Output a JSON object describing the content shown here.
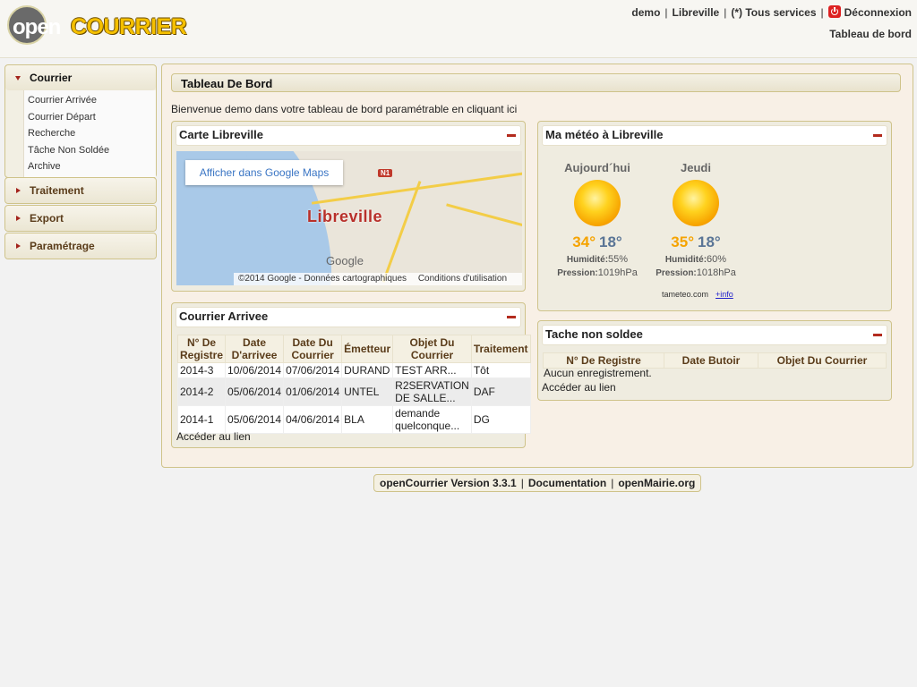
{
  "header": {
    "logo": {
      "part1": "open",
      "part2": "COURRIER"
    },
    "user": "demo",
    "collectivite": "Libreville",
    "services": "(*) Tous services",
    "logout": "Déconnexion",
    "dashboard": "Tableau de bord"
  },
  "menu": {
    "courrier": {
      "label": "Courrier",
      "items": [
        "Courrier Arrivée",
        "Courrier Départ",
        "Recherche",
        "Tâche Non Soldée",
        "Archive"
      ]
    },
    "traitement": "Traitement",
    "export": "Export",
    "parametrage": "Paramétrage"
  },
  "main": {
    "title": "Tableau De Bord",
    "welcome": "Bienvenue demo dans votre tableau de bord paramétrable en cliquant ici"
  },
  "carte": {
    "title": "Carte Libreville",
    "button": "Afficher dans Google Maps",
    "city": "Libreville",
    "road_badge": "N1",
    "brand": "Google",
    "footer": "©2014 Google - Données cartographiques",
    "terms": "Conditions d'utilisation"
  },
  "courrier_arrivee": {
    "title": "Courrier Arrivee",
    "headers": [
      "N° De Registre",
      "Date D'arrivee",
      "Date Du Courrier",
      "Émetteur",
      "Objet Du Courrier",
      "Traitement"
    ],
    "rows": [
      [
        "2014-3",
        "10/06/2014",
        "07/06/2014",
        "DURAND",
        "TEST ARR...",
        "Tôt"
      ],
      [
        "2014-2",
        "05/06/2014",
        "01/06/2014",
        "UNTEL",
        "R2SERVATION DE SALLE...",
        "DAF"
      ],
      [
        "2014-1",
        "05/06/2014",
        "04/06/2014",
        "BLA",
        "demande quelconque...",
        "DG"
      ]
    ],
    "link": "Accéder au lien"
  },
  "meteo": {
    "title": "Ma météo à Libreville",
    "days": [
      {
        "name": "Aujourd´hui",
        "icon": "sun-icon",
        "max": "34°",
        "min": "18°",
        "humidity_label": "Humidité:",
        "humidity": "55%",
        "pressure_label": "Pression:",
        "pressure": "1019hPa"
      },
      {
        "name": "Jeudi",
        "icon": "sun-icon",
        "max": "35°",
        "min": "18°",
        "humidity_label": "Humidité:",
        "humidity": "60%",
        "pressure_label": "Pression:",
        "pressure": "1018hPa"
      }
    ],
    "source": "tameteo.com",
    "more": "+info"
  },
  "tache": {
    "title": "Tache non soldee",
    "headers": [
      "N° De Registre",
      "Date Butoir",
      "Objet Du Courrier"
    ],
    "empty": "Aucun enregistrement.",
    "link": "Accéder au lien"
  },
  "footer": {
    "version": "openCourrier Version 3.3.1",
    "doc": "Documentation",
    "site": "openMairie.org"
  },
  "colors": {
    "accent_border": "#cfc38a",
    "minus": "#b32b1e",
    "temp_max": "#f5a300",
    "temp_min": "#5a7596"
  }
}
